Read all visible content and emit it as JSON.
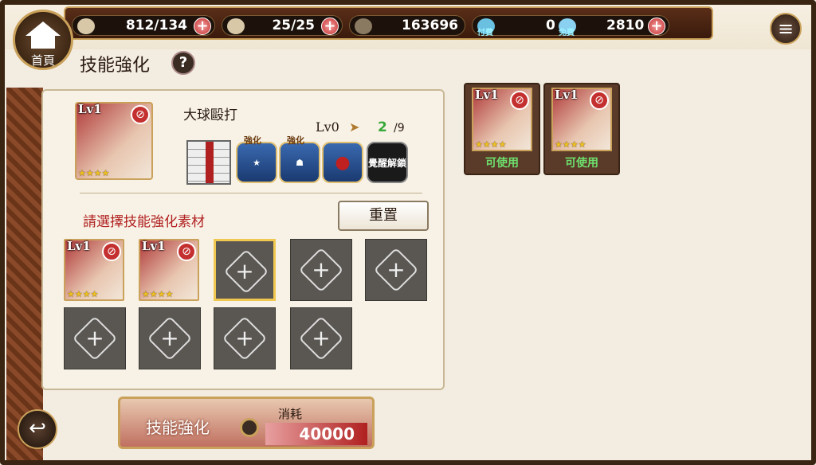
{
  "header": {
    "home_label": "首頁",
    "stamina": "812/134",
    "tickets": "25/25",
    "coins": "163696",
    "paid_label": "付費",
    "paid_value": "0",
    "free_label": "免費",
    "free_value": "2810",
    "plus_symbol": "+",
    "menu_symbol": "≡"
  },
  "page": {
    "title": "技能強化",
    "help_symbol": "?"
  },
  "skill": {
    "name": "大球毆打",
    "level": "Lv0",
    "arrow": "➤",
    "count": "2",
    "max": "/9",
    "char_level": "Lv1",
    "stars": "★★★★",
    "hex_labels": [
      "強化",
      "強化",
      "",
      "覺醒解鎖"
    ],
    "awaken_label": "覺醒解鎖"
  },
  "materials": {
    "prompt": "請選擇技能強化素材",
    "reset_label": "重置",
    "filled": [
      {
        "level": "Lv1",
        "stars": "★★★★"
      },
      {
        "level": "Lv1",
        "stars": "★★★★"
      }
    ],
    "empty_symbol": "+"
  },
  "available": [
    {
      "level": "Lv1",
      "stars": "★★★★",
      "status": "可使用"
    },
    {
      "level": "Lv1",
      "stars": "★★★★",
      "status": "可使用"
    }
  ],
  "action": {
    "label": "技能強化",
    "cost_title": "消耗",
    "cost": "40000"
  },
  "back_symbol": "↩"
}
